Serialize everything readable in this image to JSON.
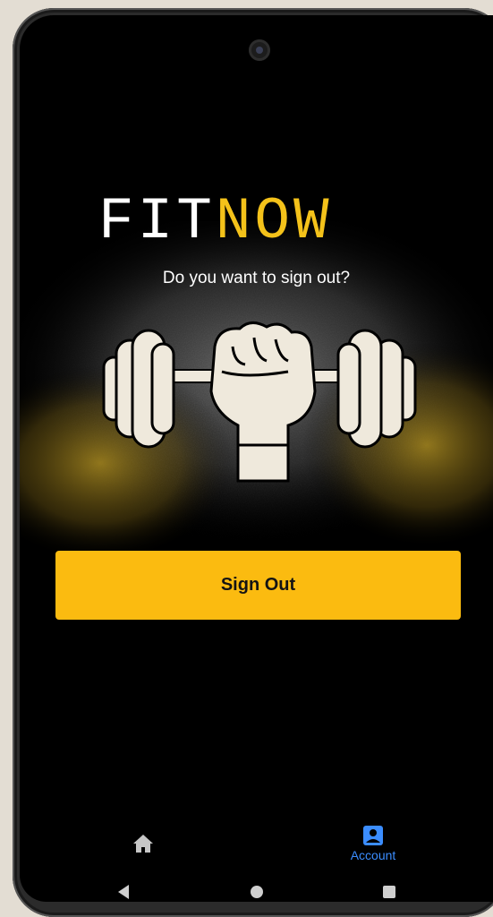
{
  "app": {
    "logo_part1": "FIT",
    "logo_part2": "NOW",
    "prompt": "Do you want to sign out?"
  },
  "actions": {
    "sign_out_label": "Sign Out"
  },
  "bottom_nav": {
    "items": [
      {
        "label": "",
        "icon": "home-icon",
        "active": false
      },
      {
        "label": "Account",
        "icon": "account-icon",
        "active": true
      }
    ]
  },
  "system_nav": {
    "buttons": [
      "back-icon",
      "home-circle-icon",
      "recents-icon"
    ]
  },
  "colors": {
    "background": "#000000",
    "accent": "#fbbb10",
    "logo_accent": "#f4c21a",
    "active_nav": "#3b8dff"
  }
}
